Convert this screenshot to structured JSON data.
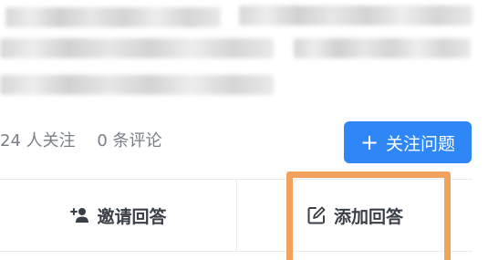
{
  "question": {
    "followers_text": "24 人关注",
    "comments_text": "0 条评论"
  },
  "follow_button": {
    "label": "关注问题",
    "icon": "plus-icon",
    "color": "#2f86f6"
  },
  "actions": {
    "invite_label": "邀请回答",
    "invite_icon": "add-user-icon",
    "add_answer_label": "添加回答",
    "add_answer_icon": "edit-icon"
  },
  "highlight": {
    "color": "#f2a25f"
  }
}
